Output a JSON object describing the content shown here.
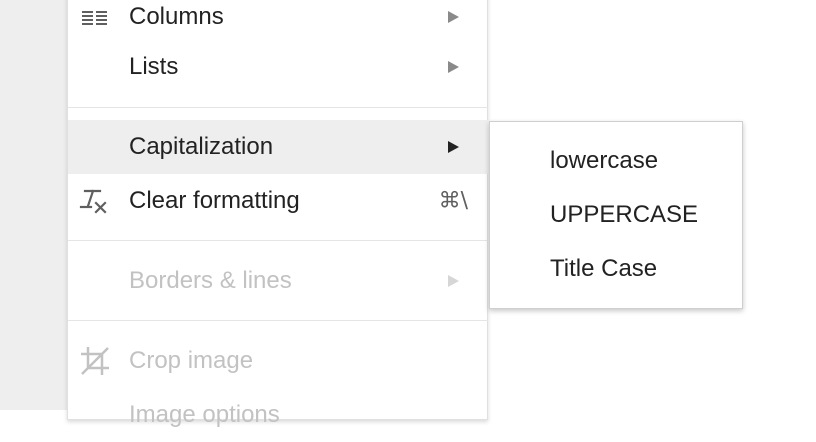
{
  "format_menu": {
    "items": [
      {
        "label": "Columns",
        "icon": "columns-icon"
      },
      {
        "label": "Lists"
      },
      {
        "label": "Capitalization"
      },
      {
        "label": "Clear formatting",
        "icon": "clear-formatting-icon",
        "shortcut": "⌘\\"
      },
      {
        "label": "Borders & lines"
      },
      {
        "label": "Crop image",
        "icon": "crop-icon"
      },
      {
        "label": "Image options"
      }
    ]
  },
  "capitalization_submenu": {
    "items": [
      {
        "label": "lowercase"
      },
      {
        "label": "UPPERCASE"
      },
      {
        "label": "Title Case"
      }
    ]
  },
  "colors": {
    "highlight": "#eeeeee",
    "text": "#222222",
    "disabled_text": "#c2c2c2",
    "page_background": "#eeeeee"
  }
}
